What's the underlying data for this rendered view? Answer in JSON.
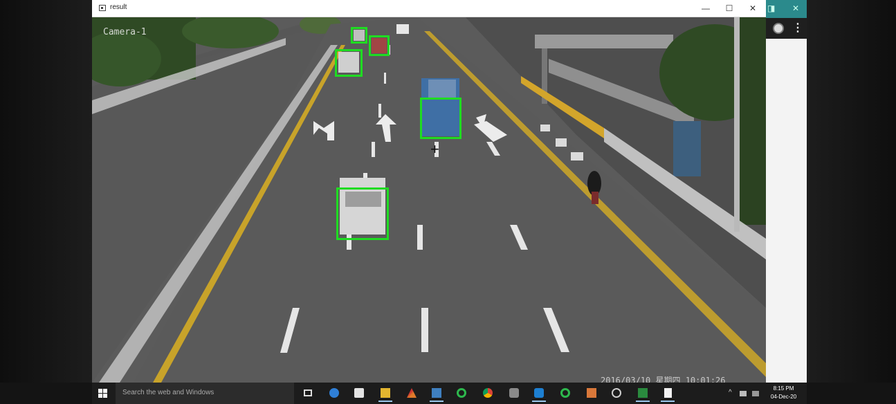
{
  "window": {
    "title": "result",
    "controls": {
      "minimize": "—",
      "maximize": "☐",
      "close": "✕"
    }
  },
  "video": {
    "camera_label": "Camera-1",
    "timestamp": "2016/03/10 星期四 10:01:26",
    "detection_color": "#1fdc22",
    "detections": [
      "car",
      "car",
      "car",
      "truck",
      "car"
    ]
  },
  "background_app": {
    "title_glyphs": [
      "◨",
      "✕"
    ],
    "avatar_icon": "user-avatar-icon",
    "menu_glyph": "⋮",
    "accent": "#2b8a8c"
  },
  "taskbar": {
    "search_placeholder": "Search the web and Windows",
    "pinned_icons": [
      "task-view-icon",
      "edge-icon",
      "store-icon",
      "file-explorer-icon",
      "matlab-icon",
      "notepad-icon",
      "circle-app-icon",
      "chrome-icon",
      "puzzle-icon",
      "teamviewer-icon",
      "circle-app-2-icon",
      "photos-icon",
      "camera-icon",
      "excel-icon",
      "document-icon"
    ],
    "tray": {
      "chevron": "^",
      "time": "8:15 PM",
      "date": "04-Dec-20"
    }
  }
}
